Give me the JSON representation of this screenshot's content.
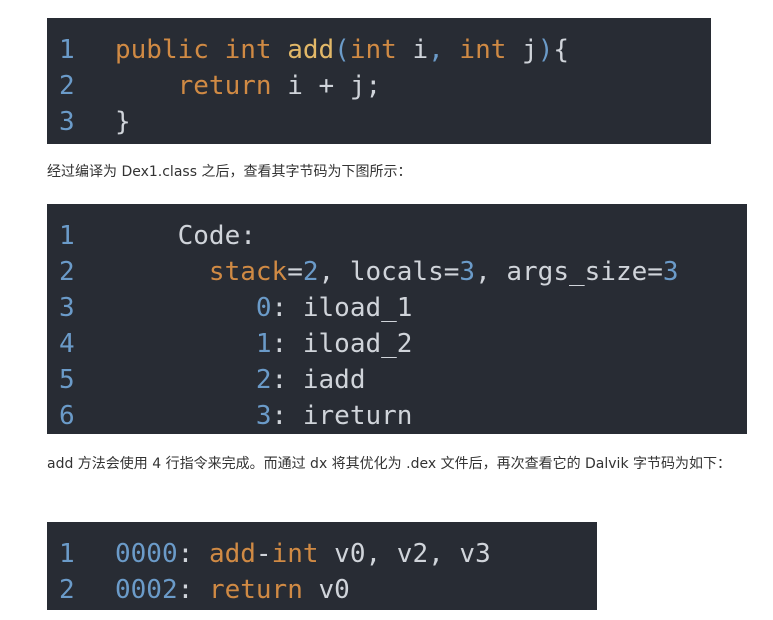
{
  "blocks": {
    "b1": {
      "lines": [
        {
          "n": "1",
          "tokens": [
            {
              "t": "public ",
              "c": "kw"
            },
            {
              "t": "int ",
              "c": "kw"
            },
            {
              "t": "add",
              "c": "fn"
            },
            {
              "t": "(",
              "c": "pn"
            },
            {
              "t": "int ",
              "c": "kw"
            },
            {
              "t": "i",
              "c": "id"
            },
            {
              "t": ", ",
              "c": "pn"
            },
            {
              "t": "int ",
              "c": "kw"
            },
            {
              "t": "j",
              "c": "id"
            },
            {
              "t": ")",
              "c": "pn"
            },
            {
              "t": "{",
              "c": "id"
            }
          ]
        },
        {
          "n": "2",
          "tokens": [
            {
              "t": "    ",
              "c": "id"
            },
            {
              "t": "return ",
              "c": "kw"
            },
            {
              "t": "i + j;",
              "c": "id"
            }
          ]
        },
        {
          "n": "3",
          "tokens": [
            {
              "t": "}",
              "c": "id"
            }
          ]
        }
      ]
    },
    "b2": {
      "lines": [
        {
          "n": "1",
          "tokens": [
            {
              "t": "    Code:",
              "c": "id"
            }
          ]
        },
        {
          "n": "2",
          "tokens": [
            {
              "t": "      ",
              "c": "id"
            },
            {
              "t": "stack",
              "c": "kw"
            },
            {
              "t": "=",
              "c": "id"
            },
            {
              "t": "2",
              "c": "num"
            },
            {
              "t": ", locals=",
              "c": "id"
            },
            {
              "t": "3",
              "c": "num"
            },
            {
              "t": ", args_size=",
              "c": "id"
            },
            {
              "t": "3",
              "c": "num"
            }
          ]
        },
        {
          "n": "3",
          "tokens": [
            {
              "t": "         ",
              "c": "id"
            },
            {
              "t": "0",
              "c": "num"
            },
            {
              "t": ": iload_1",
              "c": "id"
            }
          ]
        },
        {
          "n": "4",
          "tokens": [
            {
              "t": "         ",
              "c": "id"
            },
            {
              "t": "1",
              "c": "num"
            },
            {
              "t": ": iload_2",
              "c": "id"
            }
          ]
        },
        {
          "n": "5",
          "tokens": [
            {
              "t": "         ",
              "c": "id"
            },
            {
              "t": "2",
              "c": "num"
            },
            {
              "t": ": iadd",
              "c": "id"
            }
          ]
        },
        {
          "n": "6",
          "tokens": [
            {
              "t": "         ",
              "c": "id"
            },
            {
              "t": "3",
              "c": "num"
            },
            {
              "t": ": ireturn",
              "c": "id"
            }
          ]
        }
      ]
    },
    "b3": {
      "lines": [
        {
          "n": "1",
          "tokens": [
            {
              "t": "0000",
              "c": "num"
            },
            {
              "t": ": ",
              "c": "id"
            },
            {
              "t": "add",
              "c": "kw"
            },
            {
              "t": "-",
              "c": "id"
            },
            {
              "t": "int",
              "c": "kw"
            },
            {
              "t": " v0, v2, v3",
              "c": "id"
            }
          ]
        },
        {
          "n": "2",
          "tokens": [
            {
              "t": "0002",
              "c": "num"
            },
            {
              "t": ": ",
              "c": "id"
            },
            {
              "t": "return",
              "c": "kw"
            },
            {
              "t": " v0",
              "c": "id"
            }
          ]
        }
      ]
    }
  },
  "text": {
    "p1": "经过编译为 Dex1.class 之后，查看其字节码为下图所示：",
    "p2": "add 方法会使用 4 行指令来完成。而通过 dx 将其优化为 .dex 文件后，再次查看它的 Dalvik 字节码为如下："
  },
  "colors": {
    "background": "#282c34",
    "keyword": "#d08a44",
    "function": "#e2b868",
    "number": "#6b9bc9",
    "text": "#d0d4da"
  }
}
